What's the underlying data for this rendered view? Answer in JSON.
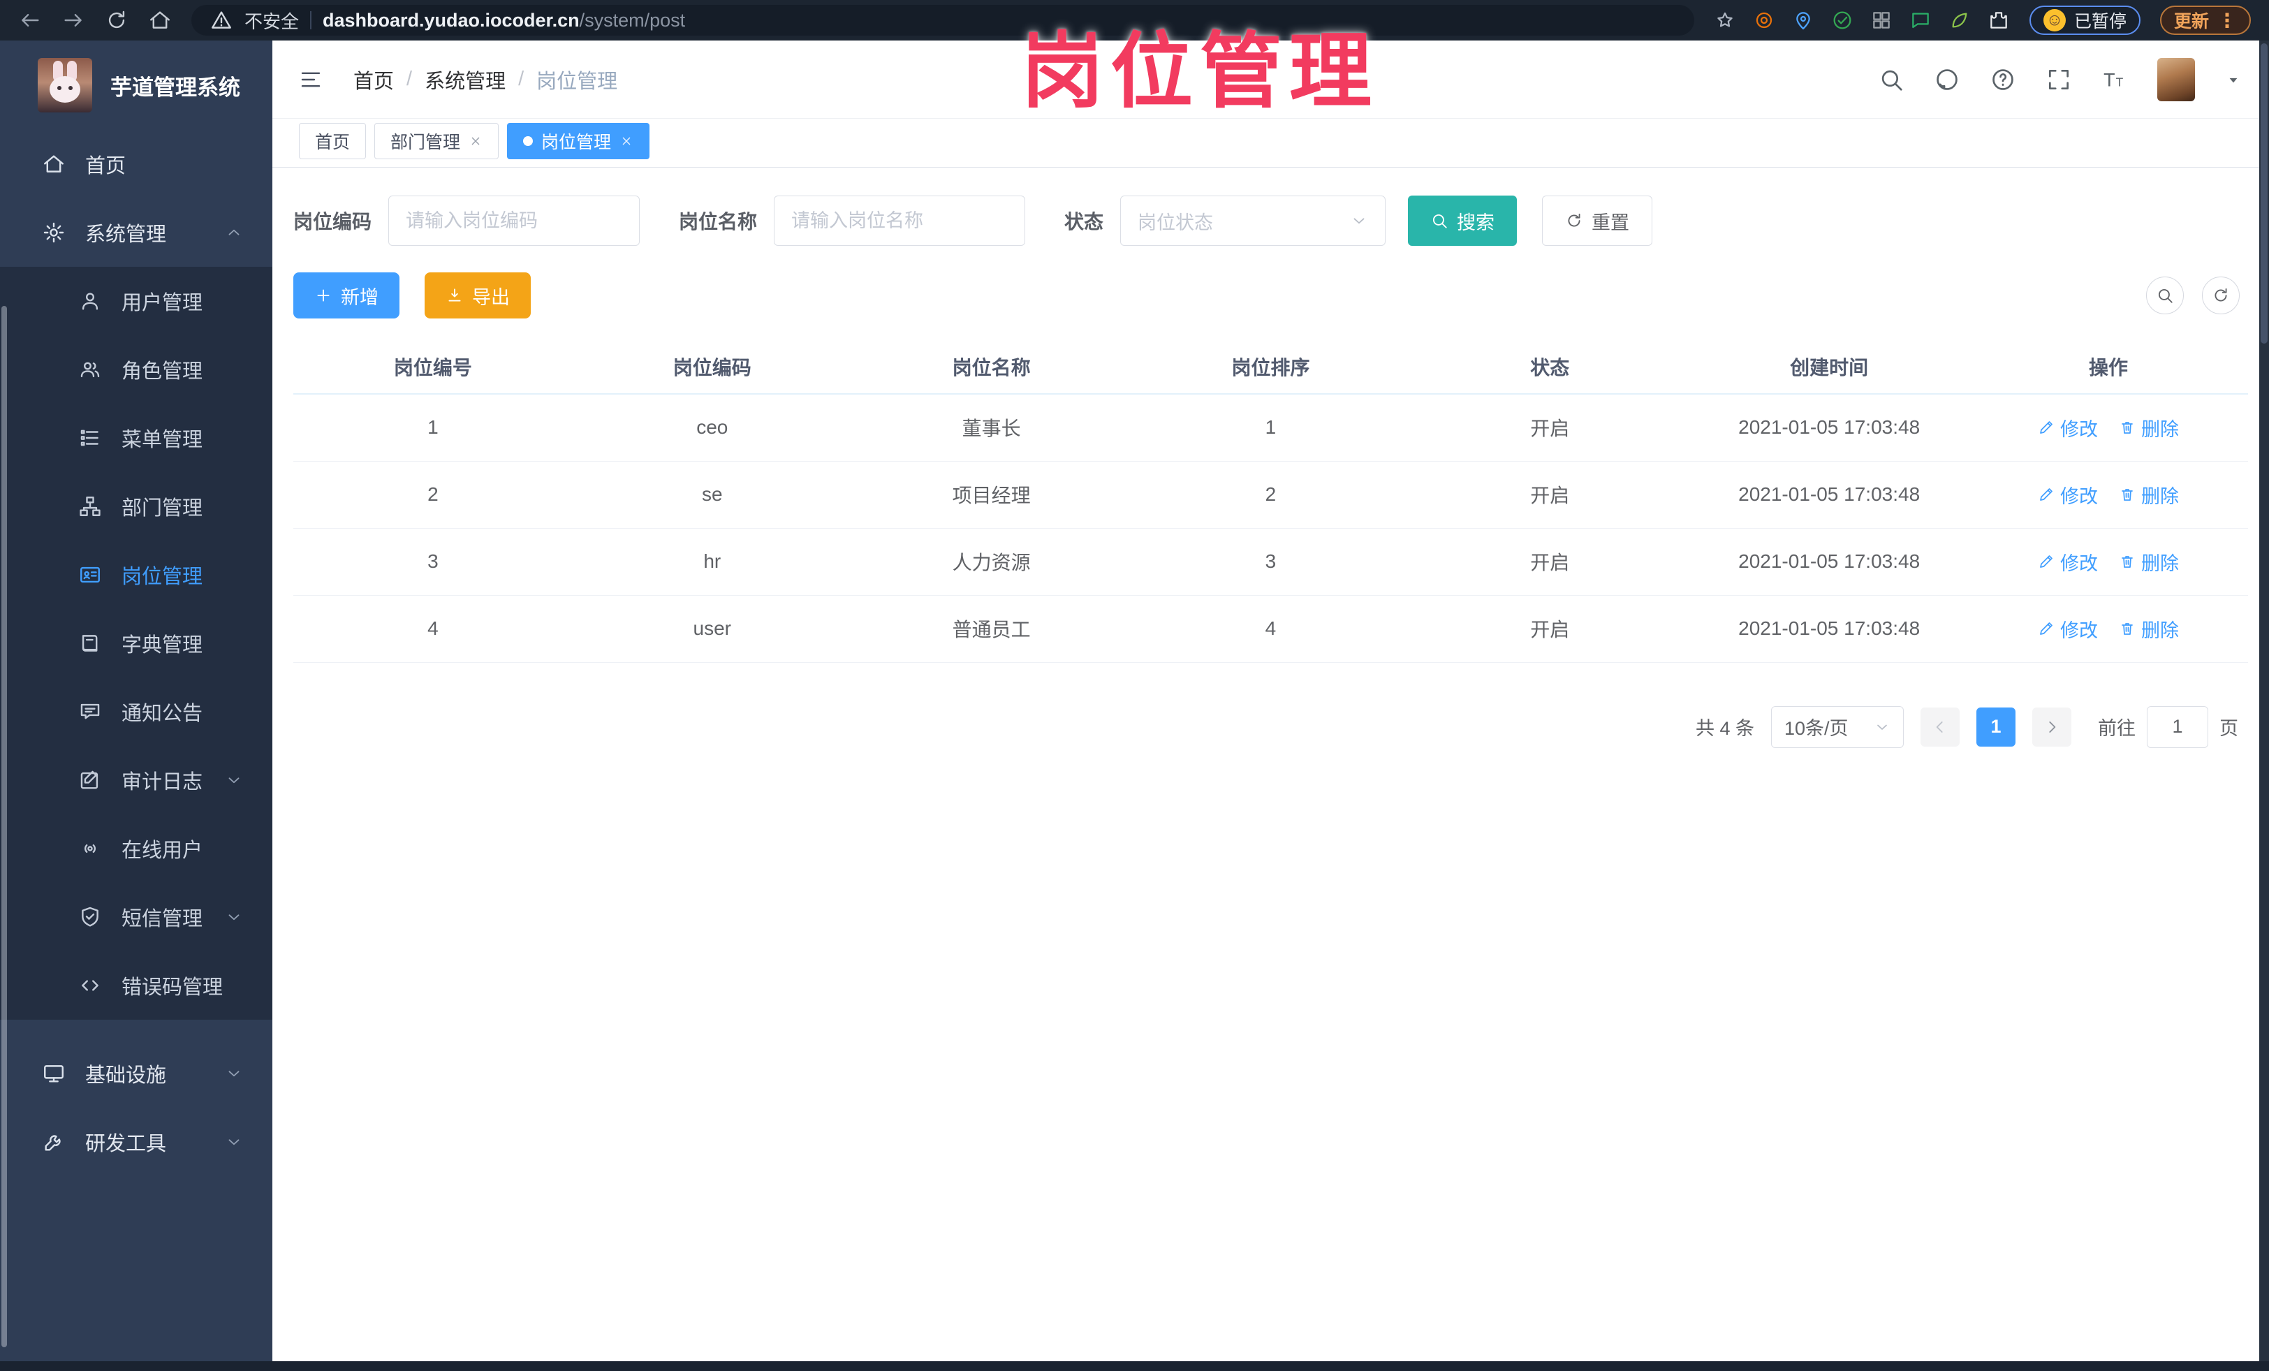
{
  "browser": {
    "security_label": "不安全",
    "url_host": "dashboard.yudao.iocoder.cn",
    "url_path": "/system/post",
    "extensions": [
      {
        "name": "bookmark-star-icon",
        "color": "#aeb6c2"
      },
      {
        "name": "ext-donut-icon",
        "color": "#e8710a"
      },
      {
        "name": "ext-pin-icon",
        "color": "#4da3ff"
      },
      {
        "name": "ext-check-badge-icon",
        "color": "#34a853"
      },
      {
        "name": "ext-grid-icon",
        "color": "#9aa0a6"
      },
      {
        "name": "ext-chat-icon",
        "color": "#2aae67"
      },
      {
        "name": "ext-leaf-icon",
        "color": "#8bc34a"
      },
      {
        "name": "ext-puzzle-icon",
        "color": "#e8eaed"
      }
    ],
    "paused_badge": "已暂停",
    "update_label": "更新",
    "kebab": "⋮"
  },
  "watermark": {
    "text": "岗位管理",
    "color": "#f23b5f"
  },
  "sidebar": {
    "title": "芋道管理系统",
    "menu_top": [
      {
        "label": "首页",
        "icon": "home-icon"
      },
      {
        "label": "系统管理",
        "icon": "gear-icon",
        "chevron": "up"
      }
    ],
    "submenu": [
      {
        "label": "用户管理",
        "icon": "user-icon"
      },
      {
        "label": "角色管理",
        "icon": "users-icon"
      },
      {
        "label": "菜单管理",
        "icon": "menu-list-icon"
      },
      {
        "label": "部门管理",
        "icon": "dept-tree-icon"
      },
      {
        "label": "岗位管理",
        "icon": "post-card-icon",
        "active": true
      },
      {
        "label": "字典管理",
        "icon": "dict-book-icon"
      },
      {
        "label": "通知公告",
        "icon": "notice-bubble-icon"
      },
      {
        "label": "审计日志",
        "icon": "audit-log-icon",
        "chevron": "down"
      },
      {
        "label": "在线用户",
        "icon": "online-user-icon"
      },
      {
        "label": "短信管理",
        "icon": "sms-shield-icon",
        "chevron": "down"
      },
      {
        "label": "错误码管理",
        "icon": "error-code-icon"
      }
    ],
    "menu_bottom": [
      {
        "label": "基础设施",
        "icon": "infra-monitor-icon",
        "chevron": "down"
      },
      {
        "label": "研发工具",
        "icon": "dev-tools-icon",
        "chevron": "down"
      }
    ]
  },
  "topbar": {
    "breadcrumb": [
      "首页",
      "系统管理",
      "岗位管理"
    ],
    "actions": [
      {
        "name": "search-icon"
      },
      {
        "name": "github-icon"
      },
      {
        "name": "question-icon"
      },
      {
        "name": "fullscreen-icon"
      },
      {
        "name": "font-size-icon"
      }
    ]
  },
  "tabs": [
    {
      "label": "首页",
      "closable": false,
      "active": false
    },
    {
      "label": "部门管理",
      "closable": true,
      "active": false
    },
    {
      "label": "岗位管理",
      "closable": true,
      "active": true
    }
  ],
  "filters": {
    "code_label": "岗位编码",
    "code_placeholder": "请输入岗位编码",
    "name_label": "岗位名称",
    "name_placeholder": "请输入岗位名称",
    "status_label": "状态",
    "status_placeholder": "岗位状态",
    "search_label": "搜索",
    "reset_label": "重置"
  },
  "toolbar": {
    "add_label": "新增",
    "export_label": "导出"
  },
  "table": {
    "columns": [
      "岗位编号",
      "岗位编码",
      "岗位名称",
      "岗位排序",
      "状态",
      "创建时间",
      "操作"
    ],
    "rows": [
      {
        "id": "1",
        "code": "ceo",
        "name": "董事长",
        "sort": "1",
        "status": "开启",
        "created": "2021-01-05 17:03:48"
      },
      {
        "id": "2",
        "code": "se",
        "name": "项目经理",
        "sort": "2",
        "status": "开启",
        "created": "2021-01-05 17:03:48"
      },
      {
        "id": "3",
        "code": "hr",
        "name": "人力资源",
        "sort": "3",
        "status": "开启",
        "created": "2021-01-05 17:03:48"
      },
      {
        "id": "4",
        "code": "user",
        "name": "普通员工",
        "sort": "4",
        "status": "开启",
        "created": "2021-01-05 17:03:48"
      }
    ],
    "edit_label": "修改",
    "delete_label": "删除"
  },
  "pagination": {
    "total_text": "共 4 条",
    "page_size": "10条/页",
    "current_page": "1",
    "goto_label": "前往",
    "goto_value": "1",
    "page_unit": "页"
  },
  "colors": {
    "primary": "#409eff",
    "search_teal": "#29b5aa",
    "export_orange": "#f4a417",
    "annotation_pink": "#f23b5f"
  }
}
